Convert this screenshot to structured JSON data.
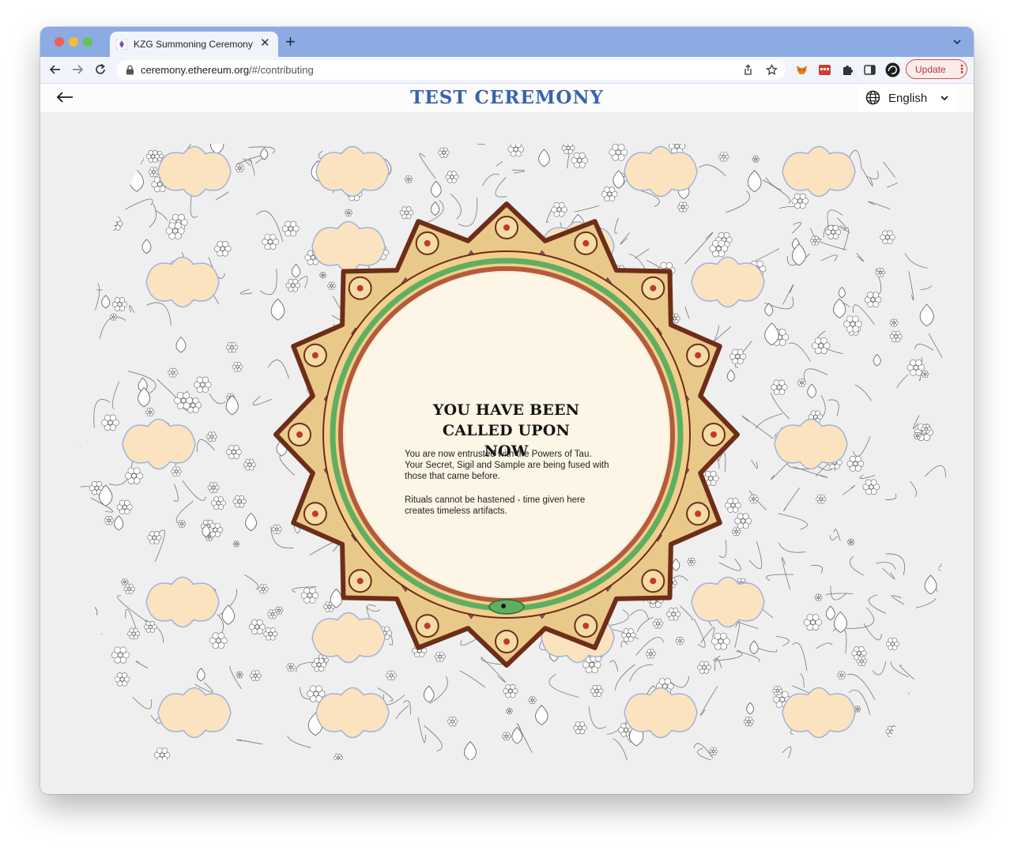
{
  "browser": {
    "tab": {
      "title": "KZG Summoning Ceremony"
    },
    "address": {
      "host": "ceremony.ethereum.org",
      "path": "/#/contributing"
    },
    "update_label": "Update"
  },
  "app": {
    "title": "TEST CEREMONY",
    "language": "English"
  },
  "content": {
    "headline": [
      "YOU HAVE BEEN",
      "CALLED UPON",
      "NOW"
    ],
    "paragraph1": "You are now entrusted with the Powers of Tau. Your Secret, Sigil and Sample are being fused with those that came before.",
    "paragraph2": "Rituals cannot be hastened - time given here creates timeless artifacts."
  },
  "colors": {
    "title_blue": "#3a63ad",
    "tab_strip": "#8cabe3",
    "update_red": "#c4554d",
    "frame_brown": "#6e2d18",
    "frame_gold": "#e9c98a",
    "snake_green": "#5fae62",
    "inner_cream": "#fdf6e6",
    "cloud_peach": "#fce3bf"
  },
  "icons": [
    "diamond-favicon-icon",
    "close-icon",
    "plus-icon",
    "chevron-down-icon",
    "back-icon",
    "forward-icon",
    "reload-icon",
    "lock-icon",
    "share-icon",
    "star-icon",
    "fox-extension-icon",
    "red-extension-icon",
    "puzzle-icon",
    "sidebar-icon",
    "profile-icon",
    "more-icon",
    "arrow-left-icon",
    "globe-icon"
  ]
}
